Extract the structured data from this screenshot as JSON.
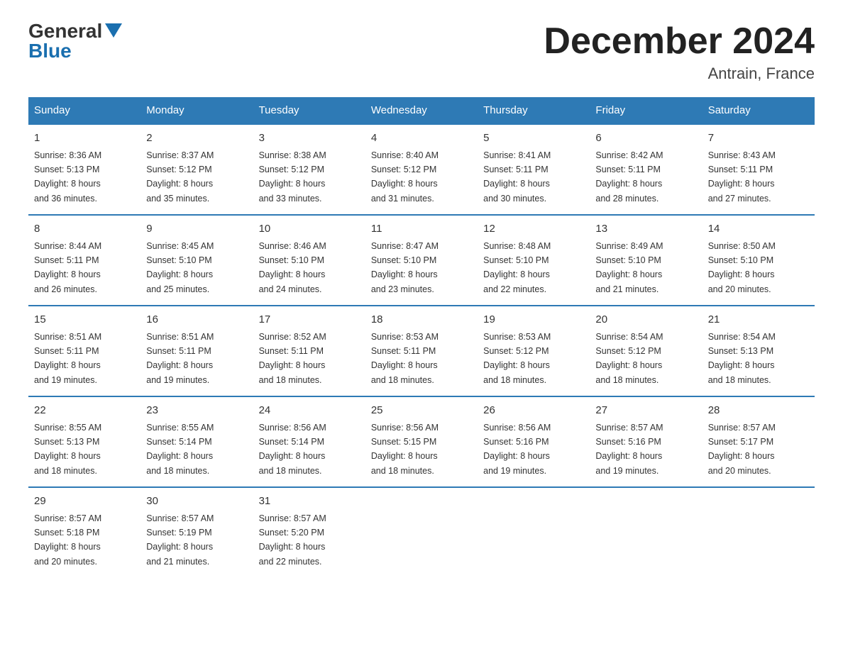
{
  "logo": {
    "general": "General",
    "blue": "Blue"
  },
  "header": {
    "month_title": "December 2024",
    "location": "Antrain, France"
  },
  "weekdays": [
    "Sunday",
    "Monday",
    "Tuesday",
    "Wednesday",
    "Thursday",
    "Friday",
    "Saturday"
  ],
  "weeks": [
    [
      {
        "day": "1",
        "sunrise": "8:36 AM",
        "sunset": "5:13 PM",
        "daylight": "8 hours and 36 minutes."
      },
      {
        "day": "2",
        "sunrise": "8:37 AM",
        "sunset": "5:12 PM",
        "daylight": "8 hours and 35 minutes."
      },
      {
        "day": "3",
        "sunrise": "8:38 AM",
        "sunset": "5:12 PM",
        "daylight": "8 hours and 33 minutes."
      },
      {
        "day": "4",
        "sunrise": "8:40 AM",
        "sunset": "5:12 PM",
        "daylight": "8 hours and 31 minutes."
      },
      {
        "day": "5",
        "sunrise": "8:41 AM",
        "sunset": "5:11 PM",
        "daylight": "8 hours and 30 minutes."
      },
      {
        "day": "6",
        "sunrise": "8:42 AM",
        "sunset": "5:11 PM",
        "daylight": "8 hours and 28 minutes."
      },
      {
        "day": "7",
        "sunrise": "8:43 AM",
        "sunset": "5:11 PM",
        "daylight": "8 hours and 27 minutes."
      }
    ],
    [
      {
        "day": "8",
        "sunrise": "8:44 AM",
        "sunset": "5:11 PM",
        "daylight": "8 hours and 26 minutes."
      },
      {
        "day": "9",
        "sunrise": "8:45 AM",
        "sunset": "5:10 PM",
        "daylight": "8 hours and 25 minutes."
      },
      {
        "day": "10",
        "sunrise": "8:46 AM",
        "sunset": "5:10 PM",
        "daylight": "8 hours and 24 minutes."
      },
      {
        "day": "11",
        "sunrise": "8:47 AM",
        "sunset": "5:10 PM",
        "daylight": "8 hours and 23 minutes."
      },
      {
        "day": "12",
        "sunrise": "8:48 AM",
        "sunset": "5:10 PM",
        "daylight": "8 hours and 22 minutes."
      },
      {
        "day": "13",
        "sunrise": "8:49 AM",
        "sunset": "5:10 PM",
        "daylight": "8 hours and 21 minutes."
      },
      {
        "day": "14",
        "sunrise": "8:50 AM",
        "sunset": "5:10 PM",
        "daylight": "8 hours and 20 minutes."
      }
    ],
    [
      {
        "day": "15",
        "sunrise": "8:51 AM",
        "sunset": "5:11 PM",
        "daylight": "8 hours and 19 minutes."
      },
      {
        "day": "16",
        "sunrise": "8:51 AM",
        "sunset": "5:11 PM",
        "daylight": "8 hours and 19 minutes."
      },
      {
        "day": "17",
        "sunrise": "8:52 AM",
        "sunset": "5:11 PM",
        "daylight": "8 hours and 18 minutes."
      },
      {
        "day": "18",
        "sunrise": "8:53 AM",
        "sunset": "5:11 PM",
        "daylight": "8 hours and 18 minutes."
      },
      {
        "day": "19",
        "sunrise": "8:53 AM",
        "sunset": "5:12 PM",
        "daylight": "8 hours and 18 minutes."
      },
      {
        "day": "20",
        "sunrise": "8:54 AM",
        "sunset": "5:12 PM",
        "daylight": "8 hours and 18 minutes."
      },
      {
        "day": "21",
        "sunrise": "8:54 AM",
        "sunset": "5:13 PM",
        "daylight": "8 hours and 18 minutes."
      }
    ],
    [
      {
        "day": "22",
        "sunrise": "8:55 AM",
        "sunset": "5:13 PM",
        "daylight": "8 hours and 18 minutes."
      },
      {
        "day": "23",
        "sunrise": "8:55 AM",
        "sunset": "5:14 PM",
        "daylight": "8 hours and 18 minutes."
      },
      {
        "day": "24",
        "sunrise": "8:56 AM",
        "sunset": "5:14 PM",
        "daylight": "8 hours and 18 minutes."
      },
      {
        "day": "25",
        "sunrise": "8:56 AM",
        "sunset": "5:15 PM",
        "daylight": "8 hours and 18 minutes."
      },
      {
        "day": "26",
        "sunrise": "8:56 AM",
        "sunset": "5:16 PM",
        "daylight": "8 hours and 19 minutes."
      },
      {
        "day": "27",
        "sunrise": "8:57 AM",
        "sunset": "5:16 PM",
        "daylight": "8 hours and 19 minutes."
      },
      {
        "day": "28",
        "sunrise": "8:57 AM",
        "sunset": "5:17 PM",
        "daylight": "8 hours and 20 minutes."
      }
    ],
    [
      {
        "day": "29",
        "sunrise": "8:57 AM",
        "sunset": "5:18 PM",
        "daylight": "8 hours and 20 minutes."
      },
      {
        "day": "30",
        "sunrise": "8:57 AM",
        "sunset": "5:19 PM",
        "daylight": "8 hours and 21 minutes."
      },
      {
        "day": "31",
        "sunrise": "8:57 AM",
        "sunset": "5:20 PM",
        "daylight": "8 hours and 22 minutes."
      },
      null,
      null,
      null,
      null
    ]
  ],
  "labels": {
    "sunrise": "Sunrise:",
    "sunset": "Sunset:",
    "daylight": "Daylight:"
  }
}
